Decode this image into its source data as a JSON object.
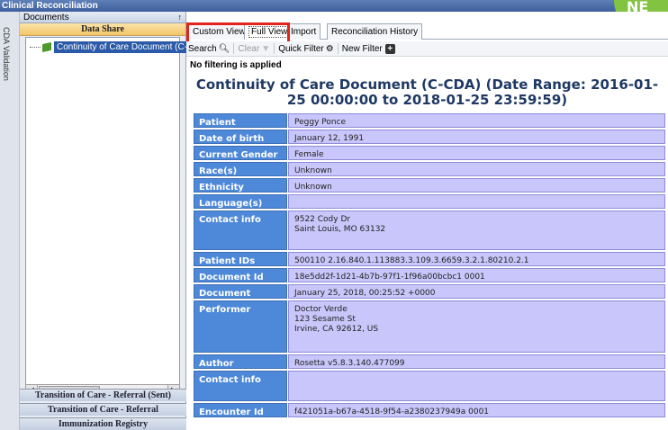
{
  "window": {
    "title": "Clinical Reconciliation",
    "badge": "NE"
  },
  "vertical_tab": {
    "label": "CDA Validation"
  },
  "left_panel": {
    "header": "Documents",
    "pin_glyph": "↑",
    "section": "Data Share",
    "tree_item": "Continuity of Care Document (C-CDA",
    "nav_buttons": [
      "Transition of Care - Referral (Sent)",
      "Transition of Care - Referral",
      "Immunization Registry"
    ]
  },
  "tabs": [
    {
      "label": "Custom View"
    },
    {
      "label": "Full View"
    },
    {
      "label": "Import"
    },
    {
      "label": "Reconciliation History"
    }
  ],
  "toolbar": {
    "search": "Search",
    "clear": "Clear",
    "quick_filter": "Quick Filter",
    "new_filter": "New Filter"
  },
  "filter_status": "No filtering is applied",
  "document": {
    "title_line1": "Continuity of Care Document (C-CDA) (Date Range: 2016-01-",
    "title_line2": "25 00:00:00 to 2018-01-25 23:59:59)",
    "rows": [
      {
        "label": "Patient",
        "value": "Peggy Ponce"
      },
      {
        "label": "Date of birth",
        "value": "January 12, 1991"
      },
      {
        "label": "Current Gender",
        "value": "Female"
      },
      {
        "label": "Race(s)",
        "value": "Unknown"
      },
      {
        "label": "Ethnicity",
        "value": "Unknown"
      },
      {
        "label": "Language(s)",
        "value": ""
      },
      {
        "label": "Contact info",
        "value": "9522 Cody Dr\nSaint Louis, MO 63132"
      },
      {
        "label": "Patient IDs",
        "value": "500110 2.16.840.1.113883.3.109.3.6659.3.2.1.80210.2.1"
      },
      {
        "label": "Document Id",
        "value": "18e5dd2f-1d21-4b7b-97f1-1f96a00bcbc1 0001"
      },
      {
        "label": "Document Created:",
        "value": "January 25, 2018, 00:25:52 +0000"
      },
      {
        "label": "Performer",
        "value": "Doctor Verde\n123 Sesame St\nIrvine, CA 92612, US"
      },
      {
        "label": "Author",
        "value": "Rosetta v5.8.3.140.477099"
      },
      {
        "label": "Contact info",
        "value": ""
      },
      {
        "label": "Encounter Id",
        "value": "f421051a-b67a-4518-9f54-a2380237949a 0001"
      }
    ]
  },
  "colors": {
    "label_bg": "#4d88d9",
    "value_bg": "#c8c6fa",
    "title_color": "#1f3864",
    "highlight": "#e2231a",
    "badge": "#82c341"
  }
}
